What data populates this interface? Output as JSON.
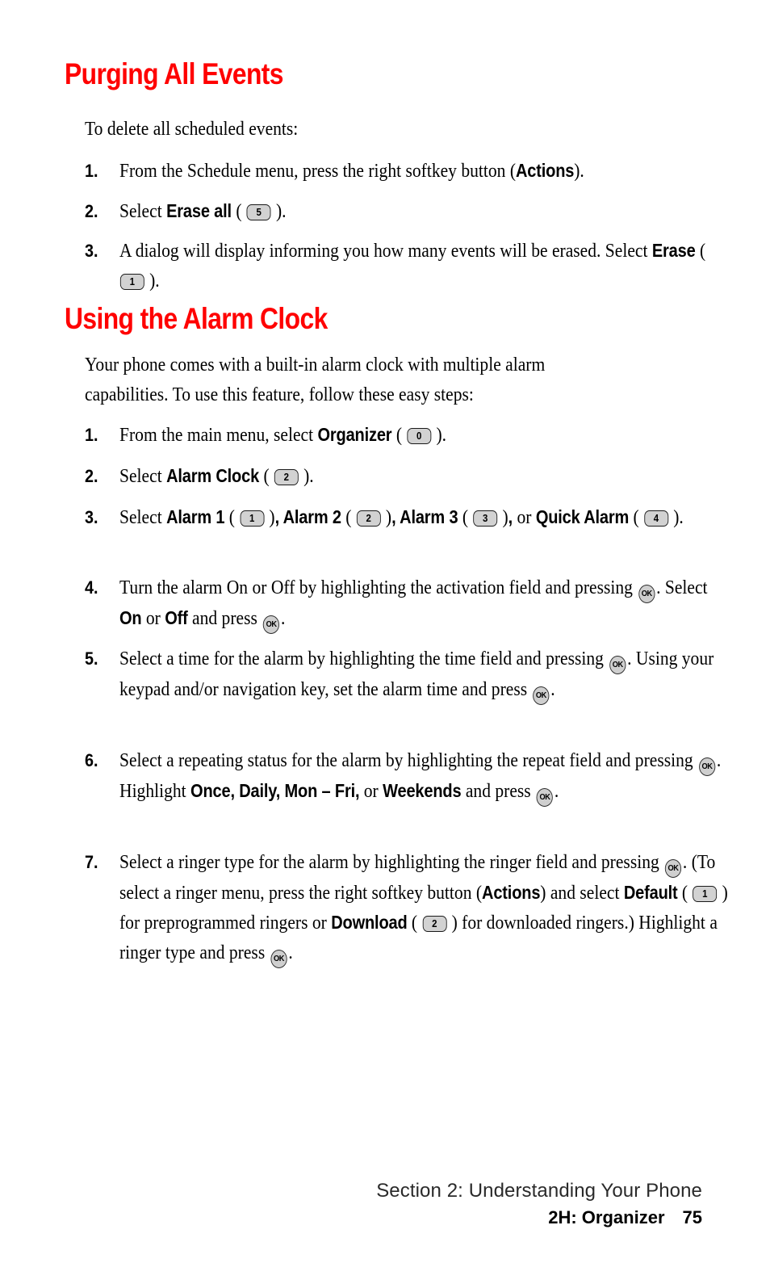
{
  "document": {
    "headings": {
      "purging": "Purging All Events",
      "alarm": "Using the Alarm Clock"
    },
    "intro": {
      "purging": "To delete all scheduled events:",
      "alarm": "Your phone comes with a built-in alarm clock with multiple alarm capabilities. To use this feature, follow these easy steps:"
    },
    "purging_steps": [
      {
        "number": "1.",
        "parts": [
          {
            "t": "text",
            "v": "From the Schedule menu, press the right softkey button ("
          },
          {
            "t": "bold",
            "v": "Actions"
          },
          {
            "t": "text",
            "v": ")."
          }
        ]
      },
      {
        "number": "2.",
        "parts": [
          {
            "t": "text",
            "v": "Select "
          },
          {
            "t": "bold",
            "v": "Erase all"
          },
          {
            "t": "text",
            "v": " ( "
          },
          {
            "t": "key",
            "v": "5"
          },
          {
            "t": "text",
            "v": " )."
          }
        ]
      },
      {
        "number": "3.",
        "parts": [
          {
            "t": "text",
            "v": "A dialog will display informing you how many events will be erased. Select "
          },
          {
            "t": "bold",
            "v": "Erase"
          },
          {
            "t": "text",
            "v": " ( "
          },
          {
            "t": "key",
            "v": "1"
          },
          {
            "t": "text",
            "v": " )."
          }
        ]
      }
    ],
    "alarm_steps": [
      {
        "number": "1.",
        "parts": [
          {
            "t": "text",
            "v": "From the main menu, select "
          },
          {
            "t": "bold",
            "v": "Organizer"
          },
          {
            "t": "text",
            "v": " ( "
          },
          {
            "t": "key",
            "v": "0"
          },
          {
            "t": "text",
            "v": " )."
          }
        ]
      },
      {
        "number": "2.",
        "parts": [
          {
            "t": "text",
            "v": "Select "
          },
          {
            "t": "bold",
            "v": "Alarm Clock"
          },
          {
            "t": "text",
            "v": " ( "
          },
          {
            "t": "key",
            "v": "2"
          },
          {
            "t": "text",
            "v": " )."
          }
        ]
      },
      {
        "number": "3.",
        "parts": [
          {
            "t": "text",
            "v": "Select "
          },
          {
            "t": "bold",
            "v": "Alarm 1"
          },
          {
            "t": "text",
            "v": " ( "
          },
          {
            "t": "key",
            "v": "1"
          },
          {
            "t": "text",
            "v": " )"
          },
          {
            "t": "bold",
            "v": ", Alarm 2"
          },
          {
            "t": "text",
            "v": " ( "
          },
          {
            "t": "key",
            "v": "2"
          },
          {
            "t": "text",
            "v": " )"
          },
          {
            "t": "bold",
            "v": ", Alarm 3"
          },
          {
            "t": "text",
            "v": " ( "
          },
          {
            "t": "key",
            "v": "3"
          },
          {
            "t": "text",
            "v": " )"
          },
          {
            "t": "bold",
            "v": ","
          },
          {
            "t": "text",
            "v": " or "
          },
          {
            "t": "bold",
            "v": "Quick Alarm"
          },
          {
            "t": "text",
            "v": " ( "
          },
          {
            "t": "key",
            "v": "4"
          },
          {
            "t": "text",
            "v": " )."
          }
        ]
      },
      {
        "number": "4.",
        "parts": [
          {
            "t": "text",
            "v": "Turn the alarm On or Off by highlighting the activation field and pressing "
          },
          {
            "t": "ok",
            "v": "OK"
          },
          {
            "t": "text",
            "v": ". Select "
          },
          {
            "t": "bold",
            "v": "On"
          },
          {
            "t": "text",
            "v": " or "
          },
          {
            "t": "bold",
            "v": "Off"
          },
          {
            "t": "text",
            "v": " and press "
          },
          {
            "t": "ok",
            "v": "OK"
          },
          {
            "t": "text",
            "v": "."
          }
        ]
      },
      {
        "number": "5.",
        "parts": [
          {
            "t": "text",
            "v": "Select a time for the alarm by highlighting the time field and pressing "
          },
          {
            "t": "ok",
            "v": "OK"
          },
          {
            "t": "text",
            "v": ". Using your keypad and/or navigation key, set the alarm time and press "
          },
          {
            "t": "ok",
            "v": "OK"
          },
          {
            "t": "text",
            "v": "."
          }
        ]
      },
      {
        "number": "6.",
        "parts": [
          {
            "t": "text",
            "v": "Select a repeating status for the alarm by highlighting the repeat field and pressing "
          },
          {
            "t": "ok",
            "v": "OK"
          },
          {
            "t": "text",
            "v": ". Highlight "
          },
          {
            "t": "bold",
            "v": "Once, Daily, Mon – Fri,"
          },
          {
            "t": "text",
            "v": " or "
          },
          {
            "t": "bold",
            "v": "Weekends"
          },
          {
            "t": "text",
            "v": " and press "
          },
          {
            "t": "ok",
            "v": "OK"
          },
          {
            "t": "text",
            "v": "."
          }
        ]
      },
      {
        "number": "7.",
        "parts": [
          {
            "t": "text",
            "v": "Select a ringer type for the alarm by highlighting the ringer field and pressing "
          },
          {
            "t": "ok",
            "v": "OK"
          },
          {
            "t": "text",
            "v": ". (To select a ringer menu, press the right softkey button ("
          },
          {
            "t": "bold",
            "v": "Actions"
          },
          {
            "t": "text",
            "v": ") and select "
          },
          {
            "t": "bold",
            "v": "Default"
          },
          {
            "t": "text",
            "v": " ( "
          },
          {
            "t": "key",
            "v": "1"
          },
          {
            "t": "text",
            "v": " ) for preprogrammed ringers or "
          },
          {
            "t": "bold",
            "v": "Download"
          },
          {
            "t": "text",
            "v": " ( "
          },
          {
            "t": "key",
            "v": "2"
          },
          {
            "t": "text",
            "v": " ) for downloaded ringers.) Highlight a ringer type and press "
          },
          {
            "t": "ok",
            "v": "OK"
          },
          {
            "t": "text",
            "v": "."
          }
        ]
      }
    ],
    "footer": {
      "section": "Section 2: Understanding Your Phone",
      "chapter": "2H: Organizer",
      "page_number": "75"
    }
  }
}
